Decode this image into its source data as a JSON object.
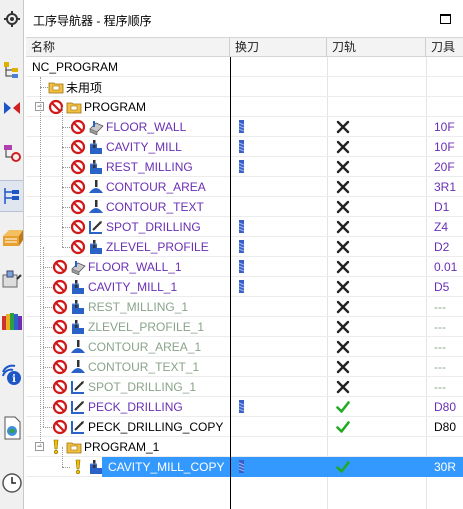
{
  "panel": {
    "title": "工序导航器 - 程序顺序"
  },
  "columns": {
    "name": "名称",
    "tool_change": "换刀",
    "toolpath": "刀轨",
    "cutter": "刀具"
  },
  "rows": [
    {
      "name": "NC_PROGRAM",
      "color": "black"
    },
    {
      "name": "未用项",
      "color": "black"
    },
    {
      "name": "PROGRAM",
      "color": "black"
    },
    {
      "name": "FLOOR_WALL",
      "color": "purple",
      "cutter": "10F",
      "tool": true,
      "path": "x"
    },
    {
      "name": "CAVITY_MILL",
      "color": "purple",
      "cutter": "10F",
      "tool": true,
      "path": "x"
    },
    {
      "name": "REST_MILLING",
      "color": "purple",
      "cutter": "20F",
      "tool": true,
      "path": "x"
    },
    {
      "name": "CONTOUR_AREA",
      "color": "purple",
      "cutter": "3R1",
      "tool": false,
      "path": "x"
    },
    {
      "name": "CONTOUR_TEXT",
      "color": "purple",
      "cutter": "D1",
      "tool": false,
      "path": "x"
    },
    {
      "name": "SPOT_DRILLING",
      "color": "purple",
      "cutter": "Z4",
      "tool": true,
      "path": "x"
    },
    {
      "name": "ZLEVEL_PROFILE",
      "color": "purple",
      "cutter": "D2",
      "tool": true,
      "path": "x"
    },
    {
      "name": "FLOOR_WALL_1",
      "color": "purple",
      "cutter": "0.01",
      "tool": true,
      "path": "x"
    },
    {
      "name": "CAVITY_MILL_1",
      "color": "purple",
      "cutter": "D5",
      "tool": true,
      "path": "x"
    },
    {
      "name": "REST_MILLING_1",
      "color": "gray",
      "cutter": "---",
      "tool": false,
      "path": "x"
    },
    {
      "name": "ZLEVEL_PROFILE_1",
      "color": "gray",
      "cutter": "---",
      "tool": false,
      "path": "x"
    },
    {
      "name": "CONTOUR_AREA_1",
      "color": "gray",
      "cutter": "---",
      "tool": false,
      "path": "x"
    },
    {
      "name": "CONTOUR_TEXT_1",
      "color": "gray",
      "cutter": "---",
      "tool": false,
      "path": "x"
    },
    {
      "name": "SPOT_DRILLING_1",
      "color": "gray",
      "cutter": "---",
      "tool": false,
      "path": "x"
    },
    {
      "name": "PECK_DRILLING",
      "color": "purple",
      "cutter": "D80",
      "tool": true,
      "path": "check"
    },
    {
      "name": "PECK_DRILLING_COPY",
      "color": "black",
      "cutter": "D80",
      "tool": false,
      "path": "check"
    },
    {
      "name": "PROGRAM_1",
      "color": "black"
    },
    {
      "name": "CAVITY_MILL_COPY",
      "color": "white",
      "cutter": "30R",
      "tool": true,
      "path": "check",
      "selected": true
    }
  ],
  "icons": {
    "toolbar": [
      "gear-icon",
      "machine-tool-view-icon",
      "geometry-view-icon",
      "method-view-icon",
      "program-order-view-icon",
      "operation-library-icon",
      "tool-library-icon",
      "color-library-icon",
      "info-icon",
      "document-icon",
      "clock-icon"
    ],
    "status": [
      "no-entry-icon",
      "warning-icon"
    ]
  },
  "colors": {
    "purple": "#6a2fb4",
    "gray": "#8aa38a",
    "selection": "#3399ff",
    "check": "#22aa22",
    "noentry": "#d01818"
  }
}
